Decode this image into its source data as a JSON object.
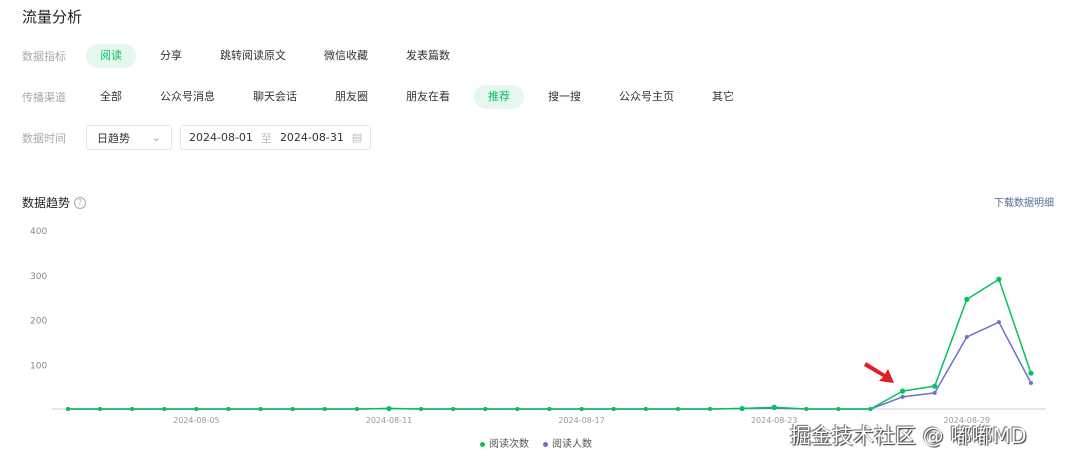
{
  "title": "流量分析",
  "metrics": {
    "label": "数据指标",
    "options": [
      "阅读",
      "分享",
      "跳转阅读原文",
      "微信收藏",
      "发表篇数"
    ],
    "active": 0
  },
  "channels": {
    "label": "传播渠道",
    "options": [
      "全部",
      "公众号消息",
      "聊天会话",
      "朋友圈",
      "朋友在看",
      "推荐",
      "搜一搜",
      "公众号主页",
      "其它"
    ],
    "active": 5
  },
  "time": {
    "label": "数据时间",
    "granularity": "日趋势",
    "start": "2024-08-01",
    "sep": "至",
    "end": "2024-08-31"
  },
  "section": {
    "title": "数据趋势",
    "help": "?",
    "download": "下载数据明细"
  },
  "watermark": "掘金技术社区 @ 嘟嘟MD",
  "colors": {
    "green": "#07c160",
    "purple": "#6b72c9"
  },
  "chart_data": {
    "type": "line",
    "x": [
      "08-01",
      "08-02",
      "08-03",
      "08-04",
      "08-05",
      "08-06",
      "08-07",
      "08-08",
      "08-09",
      "08-10",
      "08-11",
      "08-12",
      "08-13",
      "08-14",
      "08-15",
      "08-16",
      "08-17",
      "08-18",
      "08-19",
      "08-20",
      "08-21",
      "08-22",
      "08-23",
      "08-24",
      "08-25",
      "08-26",
      "08-27",
      "08-28",
      "08-29",
      "08-30",
      "08-31"
    ],
    "xticks": [
      "2024-08-05",
      "2024-08-11",
      "2024-08-17",
      "2024-08-23",
      "2024-08-29"
    ],
    "xtick_index": [
      4,
      10,
      16,
      22,
      28
    ],
    "yticks": [
      100,
      200,
      300,
      400
    ],
    "ylim": [
      0,
      400
    ],
    "series": [
      {
        "name": "阅读次数",
        "values": [
          0,
          0,
          0,
          0,
          0,
          0,
          0,
          0,
          0,
          0,
          1,
          0,
          0,
          0,
          0,
          0,
          0,
          0,
          0,
          0,
          0,
          1,
          4,
          0,
          0,
          0,
          40,
          51,
          245,
          290,
          80
        ]
      },
      {
        "name": "阅读人数",
        "values": [
          0,
          0,
          0,
          0,
          0,
          0,
          0,
          0,
          0,
          0,
          1,
          0,
          0,
          0,
          0,
          0,
          0,
          0,
          0,
          0,
          0,
          1,
          2,
          0,
          0,
          0,
          27,
          36,
          161,
          194,
          58
        ]
      }
    ]
  }
}
